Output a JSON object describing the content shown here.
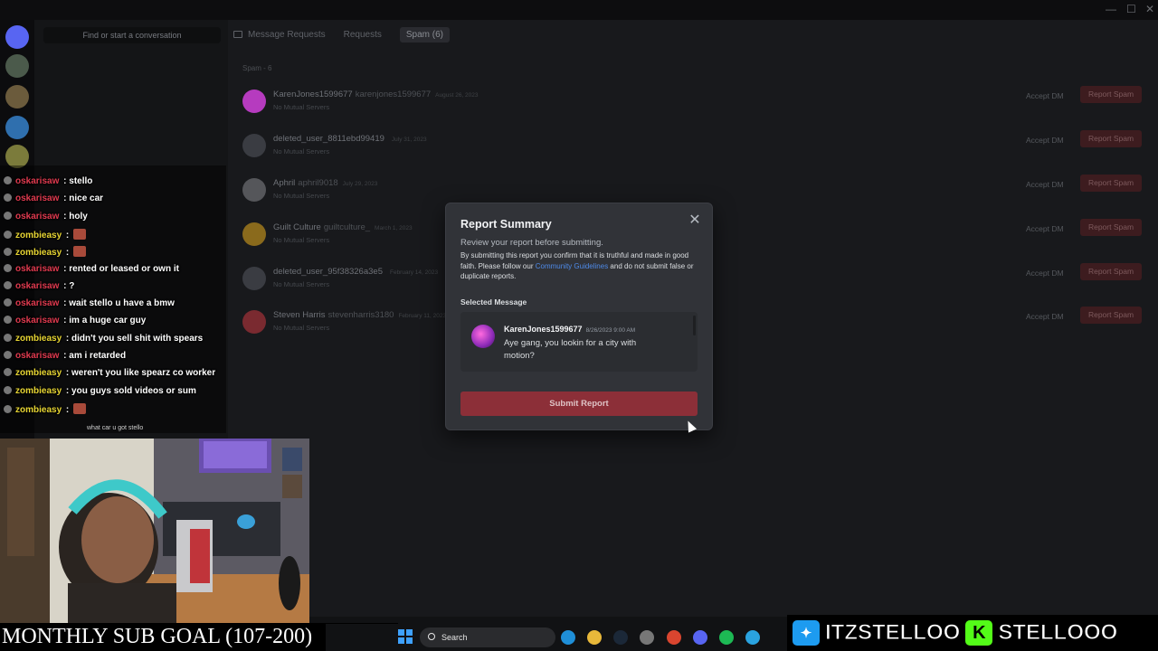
{
  "discord": {
    "dm_search_placeholder": "Find or start a conversation",
    "tabs": [
      {
        "label": "Message Requests"
      },
      {
        "label": "Requests"
      },
      {
        "label": "Spam (6)"
      }
    ],
    "spam_header": "Spam - 6",
    "requests": [
      {
        "name": "KarenJones1599677",
        "username": "karenjones1599677",
        "date": "August 26, 2023",
        "sub": "No Mutual Servers",
        "avatar_color": "#b63bbf",
        "accept": "Accept DM",
        "report": "Report Spam"
      },
      {
        "name": "deleted_user_8811ebd99419",
        "username": "",
        "date": "July 31, 2023",
        "sub": "No Mutual Servers",
        "avatar_color": "#3a3c42",
        "accept": "Accept DM",
        "report": "Report Spam"
      },
      {
        "name": "Aphril",
        "username": "aphril9018",
        "date": "July 29, 2023",
        "sub": "No Mutual Servers",
        "avatar_color": "#55565a",
        "accept": "Accept DM",
        "report": "Report Spam"
      },
      {
        "name": "Guilt Culture",
        "username": "guiltculture_",
        "date": "March 1, 2023",
        "sub": "No Mutual Servers",
        "avatar_color": "#8a6a1c",
        "accept": "Accept DM",
        "report": "Report Spam"
      },
      {
        "name": "deleted_user_95f38326a3e5",
        "username": "",
        "date": "February 14, 2023",
        "sub": "No Mutual Servers",
        "avatar_color": "#3a3c42",
        "accept": "Accept DM",
        "report": "Report Spam"
      },
      {
        "name": "Steven Harris",
        "username": "stevenharris3180",
        "date": "February 11, 2023",
        "sub": "No Mutual Servers",
        "avatar_color": "#7a2a30",
        "accept": "Accept DM",
        "report": "Report Spam"
      }
    ]
  },
  "modal": {
    "title": "Report Summary",
    "subtitle": "Review your report before submitting.",
    "note_pre": "By submitting this report you confirm that it is truthful and made in good faith. Please follow our ",
    "note_link": "Community Guidelines",
    "note_post": " and do not submit false or duplicate reports.",
    "selected_label": "Selected Message",
    "message": {
      "author": "KarenJones1599677",
      "timestamp": "8/26/2023 9:00 AM",
      "text": "Aye gang, you lookin for a city with motion?"
    },
    "submit_label": "Submit Report",
    "close_icon": "close-icon"
  },
  "chat": {
    "lines": [
      {
        "user": "oskarisaw",
        "color": "red",
        "text": "stello",
        "emote": false
      },
      {
        "user": "oskarisaw",
        "color": "red",
        "text": "nice car",
        "emote": false
      },
      {
        "user": "oskarisaw",
        "color": "red",
        "text": "holy",
        "emote": false
      },
      {
        "user": "zombieasy",
        "color": "yellow",
        "text": "",
        "emote": true
      },
      {
        "user": "zombieasy",
        "color": "yellow",
        "text": "",
        "emote": true
      },
      {
        "user": "oskarisaw",
        "color": "red",
        "text": "rented or leased or own it",
        "emote": false
      },
      {
        "user": "oskarisaw",
        "color": "red",
        "text": "?",
        "emote": false
      },
      {
        "user": "oskarisaw",
        "color": "red",
        "text": "wait stello u have a bmw",
        "emote": false
      },
      {
        "user": "oskarisaw",
        "color": "red",
        "text": "im a huge car guy",
        "emote": false
      },
      {
        "user": "zombieasy",
        "color": "yellow",
        "text": "didn't you sell shit with spears",
        "emote": false
      },
      {
        "user": "oskarisaw",
        "color": "red",
        "text": "am i retarded",
        "emote": false
      },
      {
        "user": "zombieasy",
        "color": "yellow",
        "text": "weren't you like spearz co worker",
        "emote": false
      },
      {
        "user": "zombieasy",
        "color": "yellow",
        "text": "you guys sold videos or sum",
        "emote": false
      },
      {
        "user": "zombieasy",
        "color": "yellow",
        "text": "",
        "emote": true
      }
    ],
    "pending": "what car u got stello"
  },
  "overlay": {
    "sub_goal": "MONTHLY SUB GOAL (107-200)",
    "twitter_handle": "ITZSTELLOO",
    "kick_handle": "STELLOOO",
    "twitter_icon": "twitter-icon",
    "kick_icon": "kick-icon",
    "kick_letter": "K"
  },
  "taskbar": {
    "search_label": "Search"
  }
}
